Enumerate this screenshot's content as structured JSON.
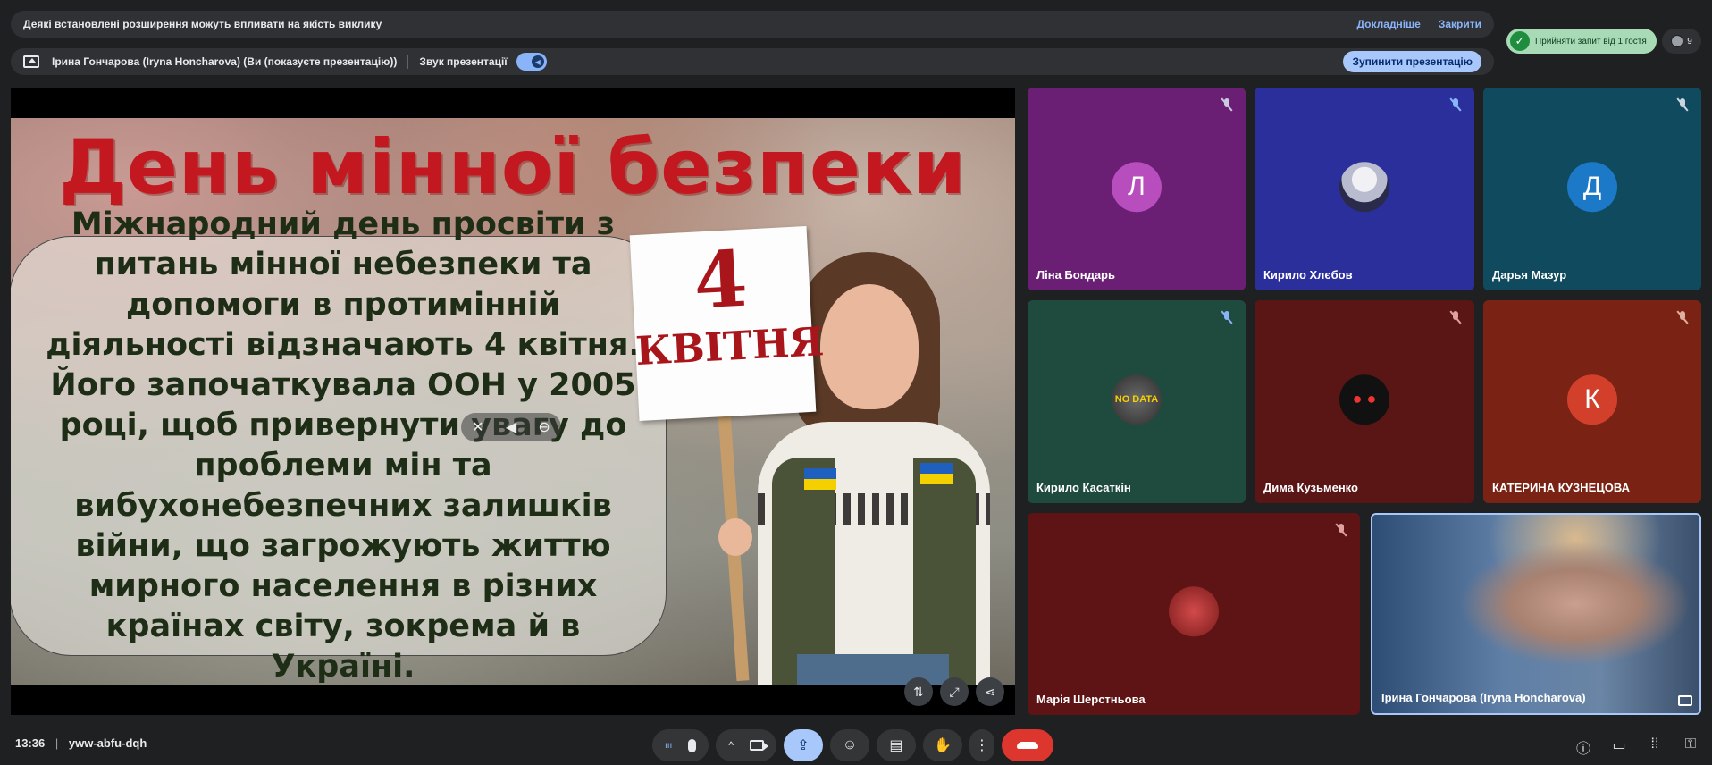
{
  "banner": {
    "message": "Деякі встановлені розширення можуть впливати на якість виклику",
    "learn_more": "Докладніше",
    "close": "Закрити"
  },
  "presenting_bar": {
    "presenter": "Ірина Гончарова (Iryna Honcharova) (Ви (показуєте презентацію))",
    "sound_label": "Звук презентації",
    "stop_button": "Зупинити презентацію"
  },
  "top_right": {
    "accept_label": "Прийняти запит від 1 гостя",
    "people_count": "9"
  },
  "slide": {
    "title": "День мінної безпеки",
    "body": "Міжнародний день просвіти з питань мінної небезпеки та допомоги в протимінній діяльності відзначають 4 квітня. Його започаткувала ООН у 2005 році, щоб привернути увагу до проблеми мін та вибухонебезпечних залишків війни, що загрожують життю мирного населення в різних країнах світу, зокрема й в Україні.",
    "sign_number": "4",
    "sign_month": "КВІТНЯ"
  },
  "participants": [
    {
      "name": "Ліна Бондарь",
      "initial": "Л",
      "avatar_color": "#b84dbd"
    },
    {
      "name": "Кирило Хлєбов",
      "initial": "",
      "avatar_color": "#d8d8e8"
    },
    {
      "name": "Дарья Мазур",
      "initial": "Д",
      "avatar_color": "#1b79c7"
    },
    {
      "name": "Кирило Касаткін",
      "initial": "",
      "avatar_color": "#555555"
    },
    {
      "name": "Дима Кузьменко",
      "initial": "",
      "avatar_color": "#1a1a1a"
    },
    {
      "name": "КАТЕРИНА КУЗНЕЦОВА",
      "initial": "К",
      "avatar_color": "#d2402b"
    },
    {
      "name": "Марія Шерстньова",
      "initial": "",
      "avatar_color": "#a32a2a"
    },
    {
      "name": "Ірина Гончарова (Iryna Honcharova)",
      "initial": "",
      "avatar_color": ""
    }
  ],
  "avatar_text": {
    "no_data": "NO DATA"
  },
  "bottom": {
    "time": "13:36",
    "meeting_code": "yww-abfu-dqh"
  },
  "colors": {
    "background": "#1f2022",
    "accent": "#a8c7fa",
    "end_call": "#dc362e",
    "accept_green": "#a8dab5",
    "slide_title": "#c41820"
  }
}
